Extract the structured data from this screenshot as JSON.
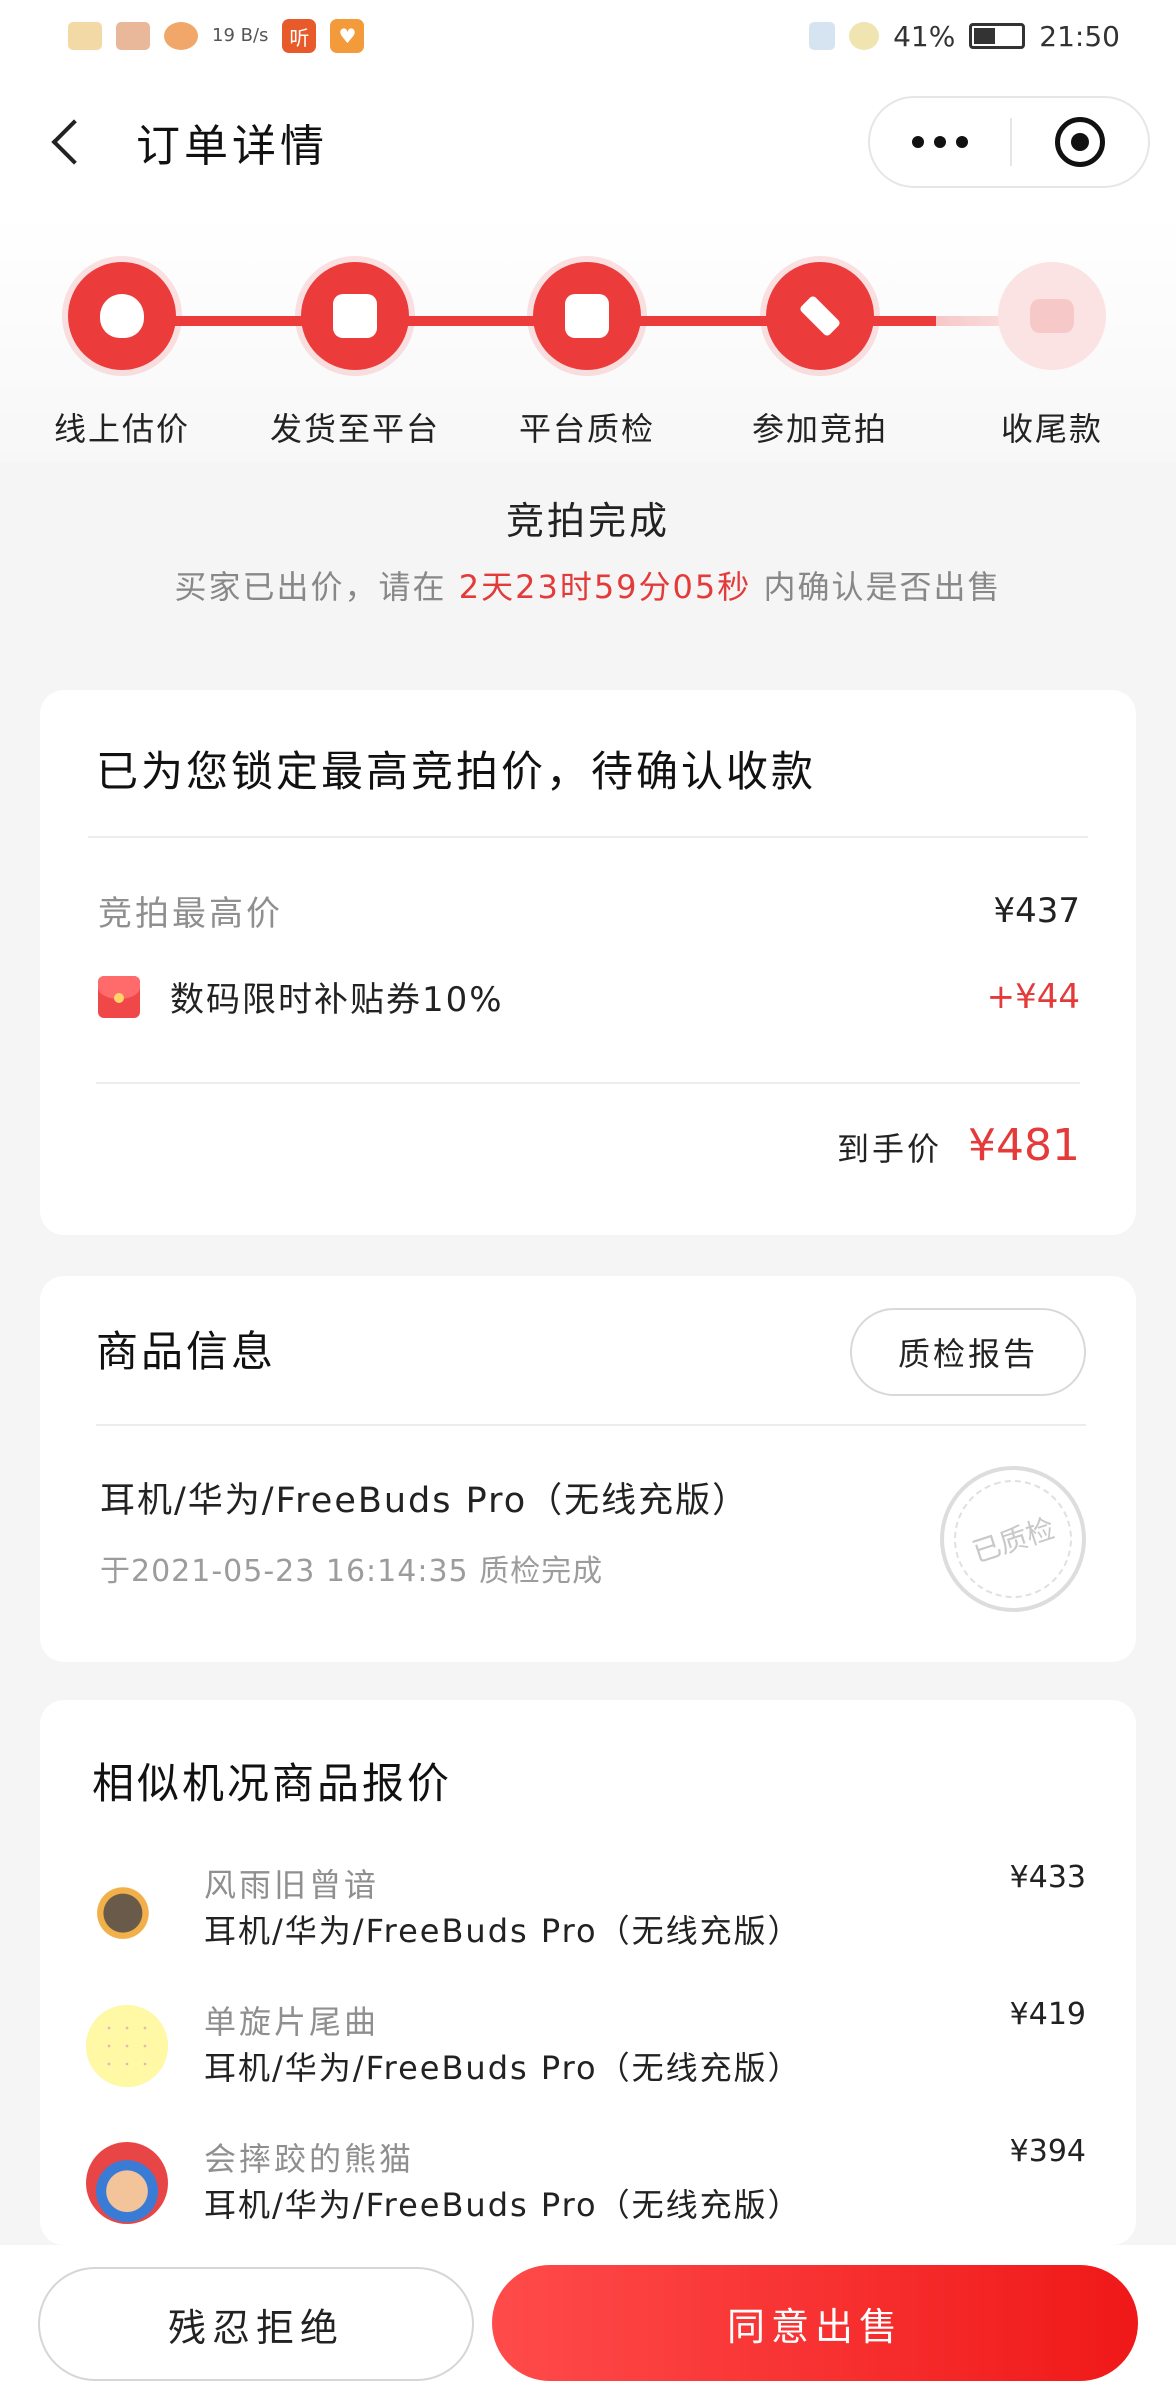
{
  "status_bar": {
    "net_speed": "19 B/s",
    "app_badge": "听",
    "battery": "41%",
    "time": "21:50"
  },
  "nav": {
    "title": "订单详情"
  },
  "progress": {
    "steps": [
      {
        "label": "线上估价",
        "icon": "money-bag-icon",
        "done": true
      },
      {
        "label": "发货至平台",
        "icon": "shipping-box-icon",
        "done": true
      },
      {
        "label": "平台质检",
        "icon": "inspect-search-icon",
        "done": true
      },
      {
        "label": "参加竞拍",
        "icon": "auction-hammer-icon",
        "done": true
      },
      {
        "label": "收尾款",
        "icon": "wallet-icon",
        "done": false
      }
    ]
  },
  "status": {
    "title": "竞拍完成",
    "desc_prefix": "买家已出价，请在",
    "countdown": "2天23时59分05秒",
    "desc_suffix": "内确认是否出售"
  },
  "price_card": {
    "title": "已为您锁定最高竞拍价，待确认收款",
    "highest_label": "竞拍最高价",
    "highest_value": "¥437",
    "coupon_label": "数码限时补贴券10%",
    "coupon_value": "+¥44",
    "total_label": "到手价",
    "total_value": "¥481"
  },
  "product_card": {
    "title": "商品信息",
    "report_button": "质检报告",
    "product_name": "耳机/华为/FreeBuds Pro（无线充版）",
    "inspect_time": "于2021-05-23 16:14:35 质检完成",
    "stamp_text": "已质检"
  },
  "similar_card": {
    "title": "相似机况商品报价",
    "items": [
      {
        "user": "风雨旧曾谙",
        "product": "耳机/华为/FreeBuds Pro（无线充版）",
        "price": "¥433"
      },
      {
        "user": "单旋片尾曲",
        "product": "耳机/华为/FreeBuds Pro（无线充版）",
        "price": "¥419"
      },
      {
        "user": "会摔跤的熊猫",
        "product": "耳机/华为/FreeBuds Pro（无线充版）",
        "price": "¥394"
      }
    ]
  },
  "actions": {
    "reject": "残忍拒绝",
    "accept": "同意出售"
  },
  "colors": {
    "accent": "#ec3b3b",
    "price_red": "#e43a3a"
  }
}
